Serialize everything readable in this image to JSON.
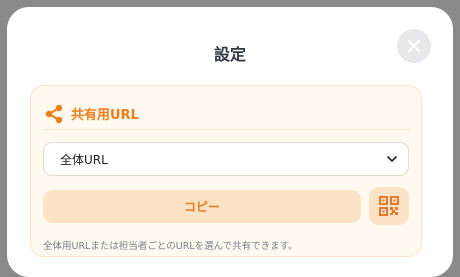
{
  "modal": {
    "title": "設定",
    "close_icon": "close-icon"
  },
  "share_card": {
    "icon": "share-icon",
    "title": "共有用URL",
    "select": {
      "selected_value": "全体URL"
    },
    "copy_label": "コピー",
    "qr_icon": "qr-code-icon",
    "hint": "全体用URLまたは担当者ごとのURLを選んで共有できます。"
  },
  "colors": {
    "accent": "#f07d1a",
    "card_bg": "#fff9f0",
    "button_bg": "#fde3c6"
  }
}
